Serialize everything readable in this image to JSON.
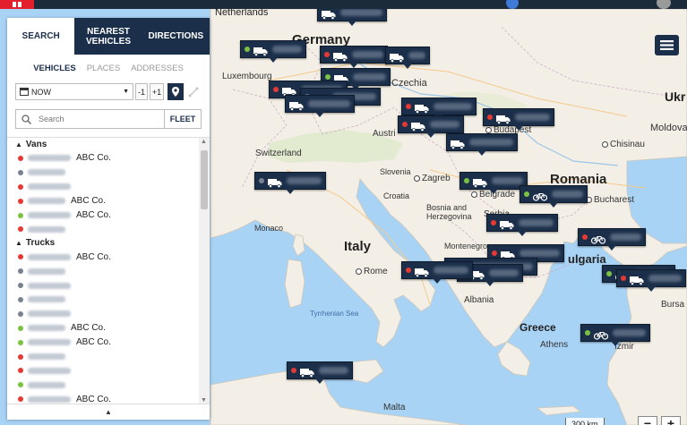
{
  "colors": {
    "navy": "#1b2f4a",
    "status_red": "#e53935",
    "status_green": "#7cc242",
    "status_gray": "#7a8290",
    "brand_red": "#e41f2d"
  },
  "panel": {
    "tabs": [
      {
        "label": "SEARCH"
      },
      {
        "label": "NEAREST VEHICLES"
      },
      {
        "label": "DIRECTIONS"
      }
    ],
    "subtabs": [
      {
        "label": "VEHICLES"
      },
      {
        "label": "PLACES"
      },
      {
        "label": "ADDRESSES"
      }
    ],
    "time": {
      "value": "NOW",
      "minus": "-1",
      "plus": "+1"
    },
    "search": {
      "placeholder": "Search",
      "fleet_label": "FLEET"
    },
    "groups": [
      {
        "name": "Vans",
        "items": [
          {
            "status": "red",
            "company": "ABC Co."
          },
          {
            "status": "gray",
            "company": ""
          },
          {
            "status": "red",
            "company": ""
          },
          {
            "status": "red",
            "company": "ABC Co."
          },
          {
            "status": "green",
            "company": "ABC Co."
          },
          {
            "status": "red",
            "company": ""
          }
        ]
      },
      {
        "name": "Trucks",
        "items": [
          {
            "status": "red",
            "company": "ABC Co."
          },
          {
            "status": "gray",
            "company": ""
          },
          {
            "status": "gray",
            "company": ""
          },
          {
            "status": "gray",
            "company": ""
          },
          {
            "status": "gray",
            "company": ""
          },
          {
            "status": "green",
            "company": "ABC Co."
          },
          {
            "status": "green",
            "company": "ABC Co."
          },
          {
            "status": "red",
            "company": ""
          },
          {
            "status": "red",
            "company": ""
          },
          {
            "status": "green",
            "company": ""
          },
          {
            "status": "red",
            "company": "ABC Co."
          }
        ]
      }
    ]
  },
  "map": {
    "labels": {
      "netherlands": "Netherlands",
      "germany": "Germany",
      "luxembourg": "Luxembourg",
      "czechia": "Czechia",
      "austria": "Austri",
      "budapest": "Budapest",
      "ukr": "Ukr",
      "moldova": "Moldova",
      "chisinau": "Chisinau",
      "switzerland": "Switzerland",
      "slovenia": "Slovenia",
      "zagreb": "Zagreb",
      "croatia": "Croatia",
      "belgrade": "Belgrade",
      "romania": "Romania",
      "bucharest": "Bucharest",
      "bosnia": "Bosnia and Herzegovina",
      "serbia": "Serbia",
      "monaco": "Monaco",
      "italy": "Italy",
      "montenegro": "Montenegro",
      "bulgaria": "ulgaria",
      "rome": "Rome",
      "tyrrhenian": "Tyrrhenian Sea",
      "albania": "Albania",
      "bursa": "Bursa",
      "greece": "Greece",
      "athens": "Athens",
      "izmir": "Izmir",
      "malta": "Malta"
    },
    "scale": "300 km",
    "zoom": {
      "minus": "−",
      "plus": "+"
    },
    "markers": [
      {
        "status": "none",
        "icon": "truck-icon"
      },
      {
        "status": "green",
        "icon": "truck-icon"
      },
      {
        "status": "red",
        "icon": "truck-icon"
      },
      {
        "status": "green",
        "icon": "truck-icon"
      },
      {
        "status": "none",
        "icon": "truck-icon"
      },
      {
        "status": "red",
        "icon": "truck-icon"
      },
      {
        "status": "gray",
        "icon": "truck-icon"
      },
      {
        "status": "none",
        "icon": "truck-icon"
      },
      {
        "status": "red",
        "icon": "truck-icon"
      },
      {
        "status": "red",
        "icon": "truck-icon"
      },
      {
        "status": "red",
        "icon": "truck-icon"
      },
      {
        "status": "none",
        "icon": "truck-icon"
      },
      {
        "status": "gray",
        "icon": "truck-icon"
      },
      {
        "status": "green",
        "icon": "truck-icon"
      },
      {
        "status": "green",
        "icon": "bicycle-icon"
      },
      {
        "status": "red",
        "icon": "truck-icon"
      },
      {
        "status": "red",
        "icon": "bicycle-icon"
      },
      {
        "status": "red",
        "icon": "truck-icon"
      },
      {
        "status": "none",
        "icon": "truck-icon"
      },
      {
        "status": "green",
        "icon": "truck-icon"
      },
      {
        "status": "red",
        "icon": "truck-icon"
      },
      {
        "status": "green",
        "icon": "bicycle-icon"
      },
      {
        "status": "red",
        "icon": "truck-icon"
      }
    ]
  }
}
